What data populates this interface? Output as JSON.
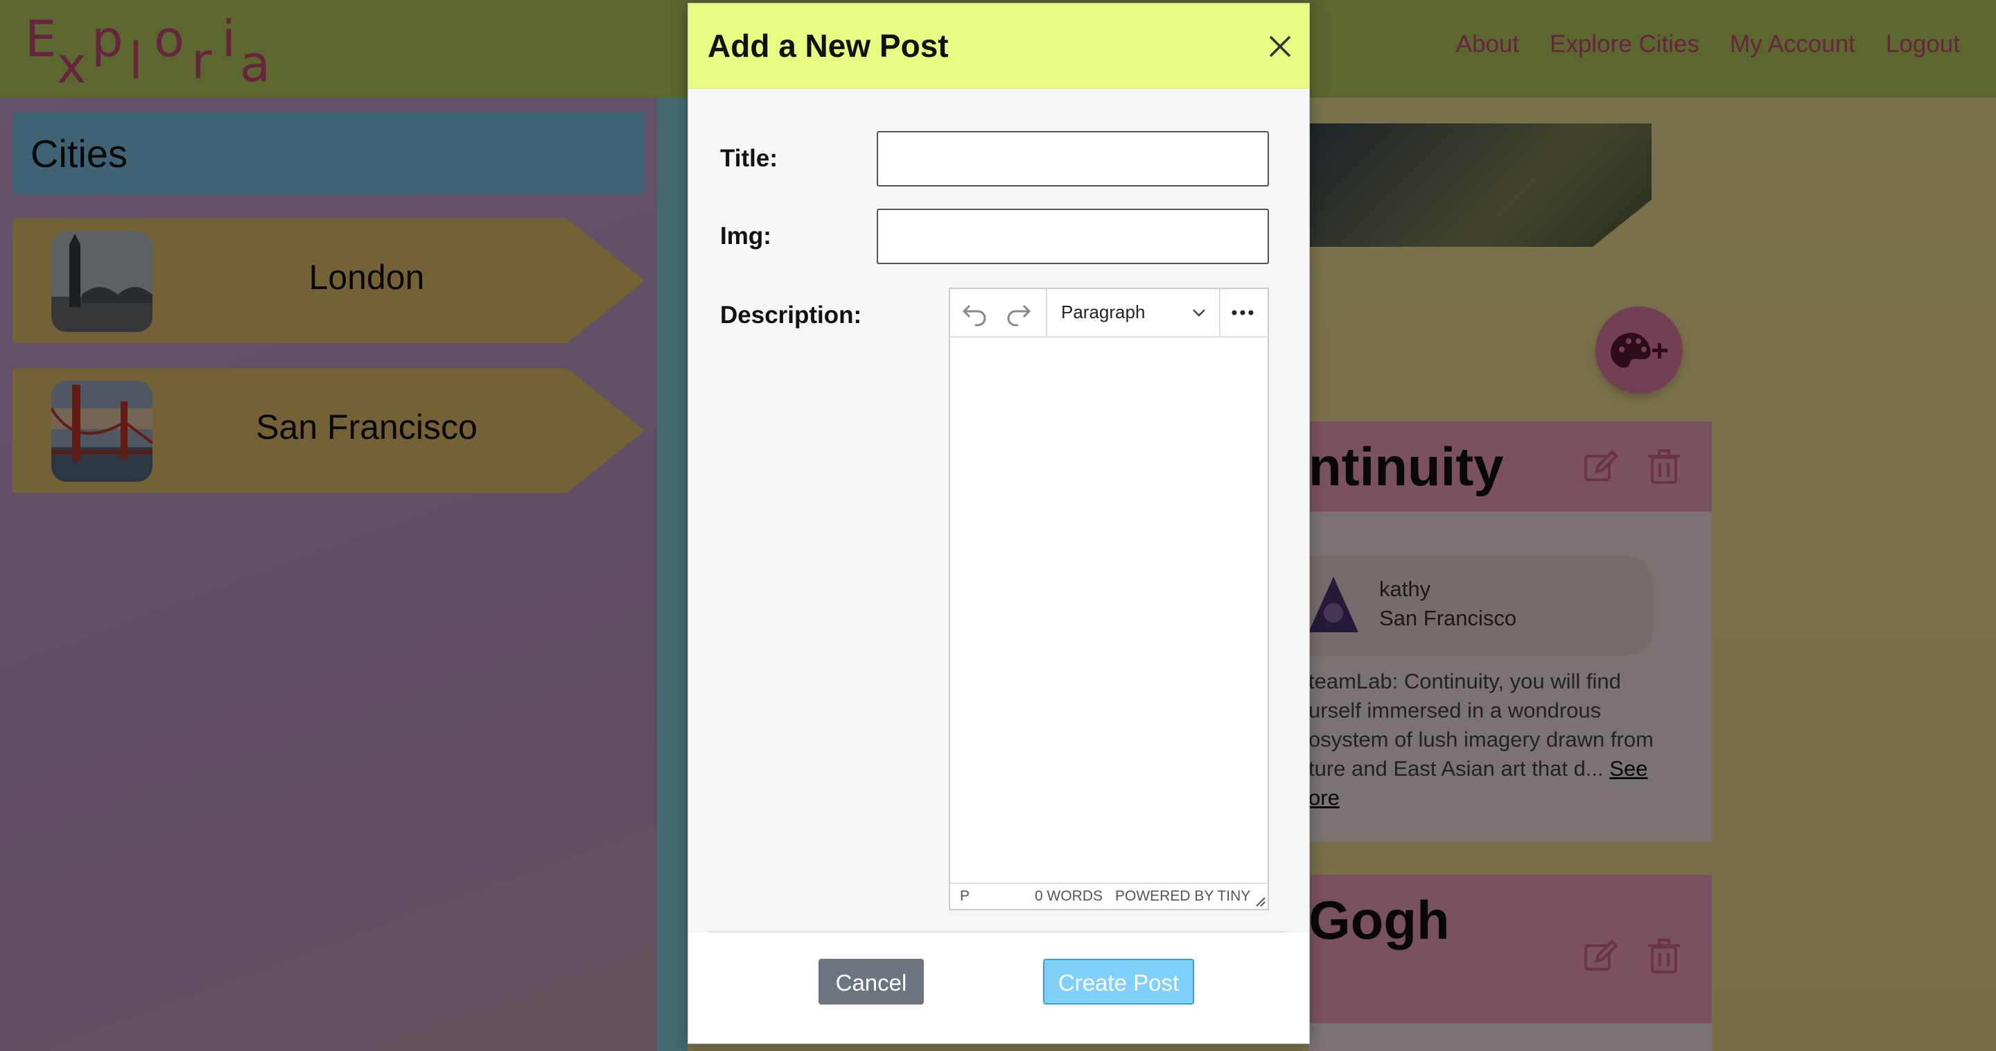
{
  "navbar": {
    "logo_letters": [
      "E",
      "x",
      "p",
      "l",
      "o",
      "r",
      "i",
      "a"
    ],
    "links": [
      {
        "label": "About"
      },
      {
        "label": "Explore Cities"
      },
      {
        "label": "My Account"
      },
      {
        "label": "Logout"
      }
    ]
  },
  "sidebar": {
    "title": "Cities",
    "cities": [
      {
        "name": "London"
      },
      {
        "name": "San Francisco"
      }
    ]
  },
  "posts": [
    {
      "title_visible": "ntinuity",
      "author": "kathy",
      "city": "San Francisco",
      "description_lines": [
        "teamLab: Continuity, you will find",
        "urself immersed in a wondrous",
        "osystem of lush imagery drawn from",
        "ture and East Asian art that d..."
      ],
      "see_more_1": "See",
      "see_more_2": "ore"
    },
    {
      "title_visible": "Gogh"
    }
  ],
  "modal": {
    "title": "Add a New Post",
    "fields": {
      "title_label": "Title:",
      "title_value": "",
      "img_label": "Img:",
      "img_value": "",
      "description_label": "Description:"
    },
    "editor": {
      "block_format": "Paragraph",
      "status_path": "P",
      "word_count": "0 WORDS",
      "powered_by": "POWERED BY TINY"
    },
    "buttons": {
      "cancel": "Cancel",
      "create": "Create Post"
    }
  },
  "colors": {
    "accent_pink": "#d1497e",
    "modal_header": "#e9fb82",
    "create_button": "#7fd0fa",
    "cancel_button": "#6c757d"
  }
}
